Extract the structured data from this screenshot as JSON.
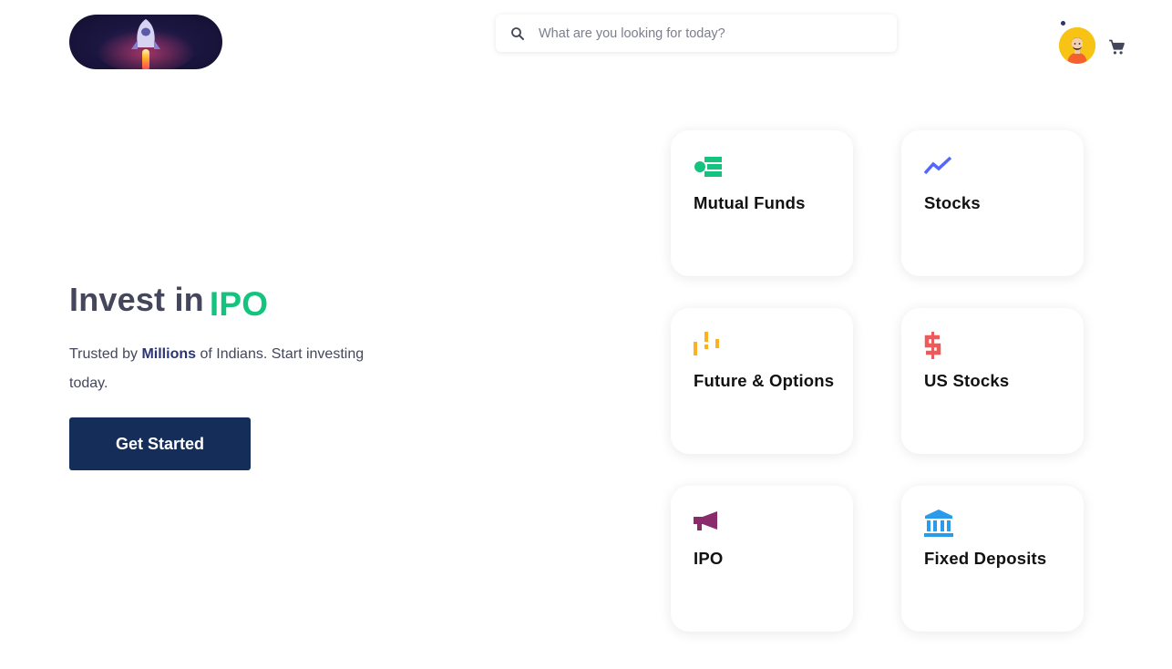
{
  "header": {
    "search": {
      "placeholder": "What are you looking for today?",
      "value": ""
    },
    "icons": {
      "search": "search-icon",
      "cart": "cart-icon",
      "avatar": "user-avatar",
      "logo": "rocket-logo"
    }
  },
  "hero": {
    "title_prefix": "Invest in",
    "title_highlight": "IPO",
    "subtitle_pre": "Trusted by",
    "subtitle_bold": "Millions",
    "subtitle_post": "of Indians. Start investing today.",
    "cta_label": "Get Started"
  },
  "products": [
    {
      "label": "Mutual Funds",
      "icon": "mutual-funds-icon",
      "color": "#14c47e"
    },
    {
      "label": "Stocks",
      "icon": "trending-up-icon",
      "color": "#5367ff"
    },
    {
      "label": "Future & Options",
      "icon": "candlestick-icon",
      "color": "#fdb022"
    },
    {
      "label": "US Stocks",
      "icon": "dollar-icon",
      "color": "#eb5b5b"
    },
    {
      "label": "IPO",
      "icon": "megaphone-icon",
      "color": "#8a2b6b"
    },
    {
      "label": "Fixed Deposits",
      "icon": "bank-icon",
      "color": "#2a9bea"
    }
  ],
  "colors": {
    "accent": "#14c47e",
    "cta": "#142d59",
    "text": "#44475b",
    "brand_bold": "#2b3573"
  }
}
